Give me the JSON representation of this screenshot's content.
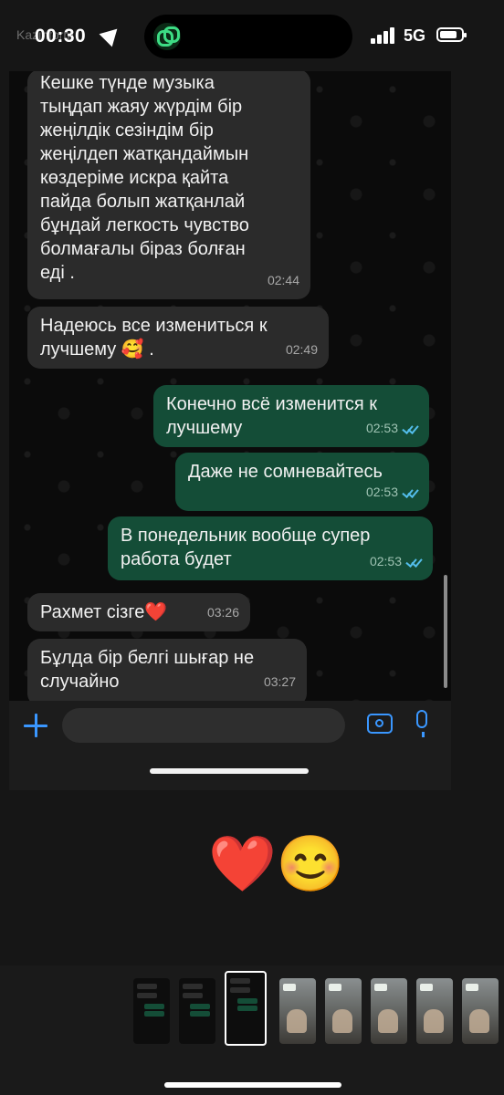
{
  "status_bar": {
    "time": "00:30",
    "network": "5G",
    "watermark": "Kazinform"
  },
  "chat": {
    "messages": [
      {
        "dir": "in",
        "text": "Кешке түнде музыка\nтыңдап  жаяу жүрдім бір\nжеңілдік сезіндім бір\nжеңілдеп жатқандаймын\nкөздеріме искра қайта\nпайда болып жатқанлай\nбұндай легкость чувство\nболмағалы біраз болған\nеді .",
        "time": "02:44"
      },
      {
        "dir": "in",
        "text": "Надеюсь все измениться к\nлучшему 🥰 .",
        "time": "02:49"
      },
      {
        "dir": "out",
        "text": "Конечно всё изменится к\nлучшему",
        "time": "02:53"
      },
      {
        "dir": "out",
        "text": "Даже не сомневайтесь",
        "time": "02:53"
      },
      {
        "dir": "out",
        "text": "В понедельник вообще супер\nработа будет",
        "time": "02:53"
      },
      {
        "dir": "in",
        "text": "Рахмет сізге❤️",
        "time": "03:26"
      },
      {
        "dir": "in",
        "text": "Бұлда бір белгі шығар не\nслучайно",
        "time": "03:27"
      }
    ],
    "input_placeholder": "",
    "icons": [
      "plus-icon",
      "sticker-icon",
      "camera-icon",
      "mic-icon"
    ]
  },
  "reactions": "❤️😊",
  "thumbnails": [
    "chat",
    "chat",
    "chat",
    "photo",
    "photo",
    "photo",
    "photo",
    "photo"
  ],
  "colors": {
    "incoming_bubble": "#2b2b2b",
    "outgoing_bubble": "#144d37",
    "accent": "#3a97ff",
    "read_ticks": "#53bdeb"
  }
}
